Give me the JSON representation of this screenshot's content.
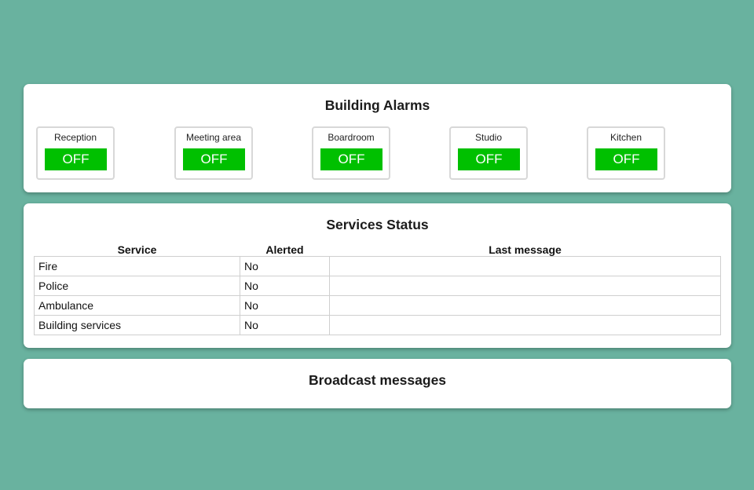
{
  "alarms": {
    "title": "Building Alarms",
    "items": [
      {
        "label": "Reception",
        "state": "OFF"
      },
      {
        "label": "Meeting area",
        "state": "OFF"
      },
      {
        "label": "Boardroom",
        "state": "OFF"
      },
      {
        "label": "Studio",
        "state": "OFF"
      },
      {
        "label": "Kitchen",
        "state": "OFF"
      }
    ],
    "state_color": "#00c000"
  },
  "services": {
    "title": "Services Status",
    "columns": [
      "Service",
      "Alerted",
      "Last message"
    ],
    "rows": [
      {
        "service": "Fire",
        "alerted": "No",
        "last_message": ""
      },
      {
        "service": "Police",
        "alerted": "No",
        "last_message": ""
      },
      {
        "service": "Ambulance",
        "alerted": "No",
        "last_message": ""
      },
      {
        "service": "Building services",
        "alerted": "No",
        "last_message": ""
      }
    ]
  },
  "broadcast": {
    "title": "Broadcast messages"
  }
}
